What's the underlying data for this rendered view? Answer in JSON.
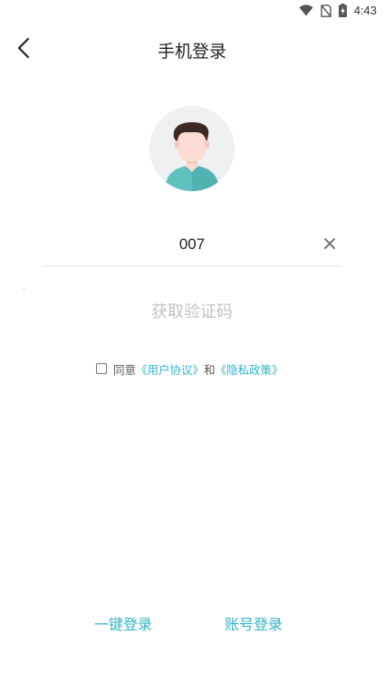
{
  "status_bar": {
    "time": "4:43",
    "icons": [
      "wifi-icon",
      "no-sim-icon",
      "battery-charging-icon"
    ]
  },
  "header": {
    "title": "手机登录",
    "back_icon": "back-arrow-icon"
  },
  "avatar": {
    "icon": "default-avatar-icon",
    "colors": {
      "background": "#eef0f1",
      "shirt": "#5ec1bd",
      "skin": "#fcdcd0",
      "hair": "#3b2a24"
    }
  },
  "phone_input": {
    "value": "007",
    "clear_icon": "close-icon"
  },
  "captcha_button": {
    "label": "获取验证码"
  },
  "agreement": {
    "checked": false,
    "prefix": "同意",
    "user_agreement": "《用户协议》",
    "conjunction": "和",
    "privacy_policy": "《隐私政策》"
  },
  "bottom_links": {
    "one_key_login": "一键登录",
    "account_login": "账号登录"
  },
  "colors": {
    "accent": "#33b3c9",
    "disabled_text": "#c2c2c2",
    "divider": "#e3e3e3"
  }
}
